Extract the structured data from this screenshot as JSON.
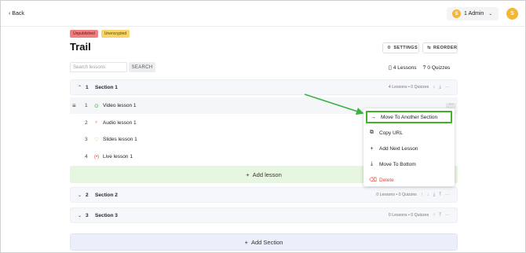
{
  "topbar": {
    "back_label": "‹ Back",
    "admin": {
      "avatar_initial": "S",
      "label": "1 Admin",
      "caret": "⌄"
    },
    "user_avatar_initial": "S"
  },
  "course": {
    "badges": [
      "Unpublished",
      "Unencrypted"
    ],
    "title": "Trail",
    "settings_label": "SETTINGS",
    "reorder_label": "REORDER"
  },
  "search": {
    "placeholder": "Search lessons",
    "button_label": "SEARCH"
  },
  "counts": {
    "lessons": "4 Lessons",
    "quizzes": "0 Quizzes"
  },
  "sections": [
    {
      "num": "1",
      "title": "Section 1",
      "meta": "4 Lessons • 0 Quizzes",
      "expanded": true,
      "lessons": [
        {
          "num": "1",
          "title": "Video lesson 1",
          "icon": "video-icon",
          "icon_glyph": "⊙",
          "icon_color": "#2fa84f"
        },
        {
          "num": "2",
          "title": "Audio lesson 1",
          "icon": "audio-icon",
          "icon_glyph": "♆",
          "icon_color": "#e8703a"
        },
        {
          "num": "3",
          "title": "Slides lesson 1",
          "icon": "slides-icon",
          "icon_glyph": "♡",
          "icon_color": "#e5a800"
        },
        {
          "num": "4",
          "title": "Live lesson 1",
          "icon": "live-icon",
          "icon_glyph": "(•)",
          "icon_color": "#e0463c"
        }
      ],
      "add_lesson_label": "Add lesson"
    },
    {
      "num": "2",
      "title": "Section 2",
      "meta": "0 Lessons • 0 Quizzes",
      "expanded": false
    },
    {
      "num": "3",
      "title": "Section 3",
      "meta": "0 Lessons • 0 Quizzes",
      "expanded": false
    }
  ],
  "add_section_label": "Add Section",
  "context_menu": {
    "items": [
      {
        "label": "Move To Another Section",
        "icon": "arrow-right-icon",
        "glyph": "→",
        "highlighted": true
      },
      {
        "label": "Copy URL",
        "icon": "link-icon",
        "glyph": "⧉"
      },
      {
        "label": "Add Next Lesson",
        "icon": "plus-icon",
        "glyph": "+"
      },
      {
        "label": "Move To Bottom",
        "icon": "move-bottom-icon",
        "glyph": "⤓"
      },
      {
        "label": "Delete",
        "icon": "trash-icon",
        "glyph": "🗑",
        "danger": true
      }
    ]
  },
  "colors": {
    "annotation_arrow": "#3cb043",
    "add_lesson_bg": "#e7f6e1",
    "badge_unpublished": "#f07f7f",
    "badge_unencrypted": "#f7d56b",
    "avatar": "#f5b731"
  }
}
